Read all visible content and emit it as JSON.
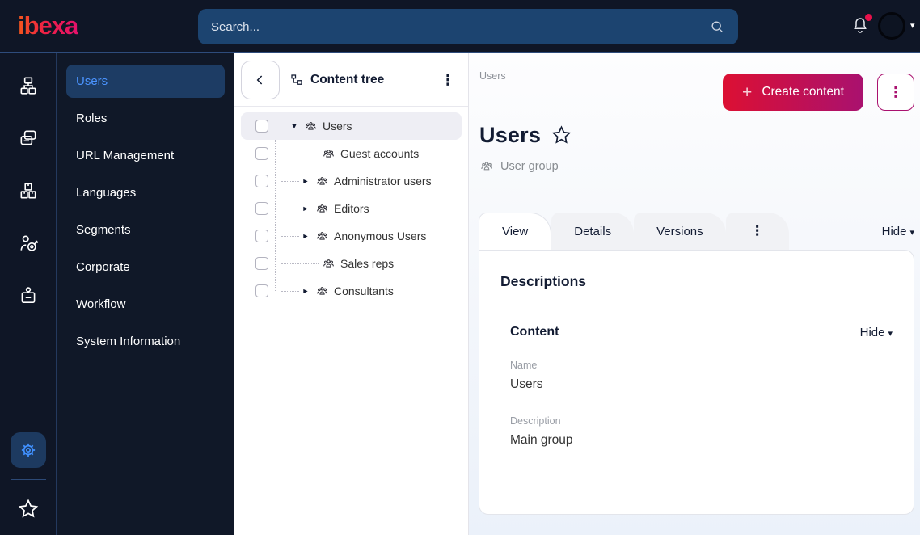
{
  "topbar": {
    "logo_text": "ibexa",
    "search_placeholder": "Search..."
  },
  "icons": {
    "caret_down": "▼",
    "caret_right": "►",
    "kebab": "⋮",
    "dropdown_caret": "▾",
    "plus": "+"
  },
  "sidebar": {
    "selected": "Users",
    "items": [
      "Users",
      "Roles",
      "URL Management",
      "Languages",
      "Segments",
      "Corporate",
      "Workflow",
      "System Information"
    ]
  },
  "content_tree": {
    "title": "Content tree",
    "items": [
      {
        "label": "Users",
        "expanded": true,
        "has_children": true,
        "selected": true
      },
      {
        "label": "Guest accounts",
        "has_children": false
      },
      {
        "label": "Administrator users",
        "has_children": true
      },
      {
        "label": "Editors",
        "has_children": true
      },
      {
        "label": "Anonymous Users",
        "has_children": true
      },
      {
        "label": "Sales reps",
        "has_children": false
      },
      {
        "label": "Consultants",
        "has_children": true
      }
    ]
  },
  "main": {
    "breadcrumb": "Users",
    "create_button_label": "Create content",
    "title": "Users",
    "content_type": "User group",
    "tabs": [
      "View",
      "Details",
      "Versions"
    ],
    "hide_label": "Hide",
    "panel": {
      "heading": "Descriptions",
      "section_title": "Content",
      "section_hide_label": "Hide",
      "fields": [
        {
          "label": "Name",
          "value": "Users"
        },
        {
          "label": "Description",
          "value": "Main group"
        }
      ]
    }
  },
  "colors": {
    "dark_bg": "#0f1626",
    "search_bg": "#1c4470",
    "selected_nav_bg": "#1d3c64",
    "link_blue": "#4191ff",
    "accent_gradient_start": "#dc1033",
    "accent_gradient_end": "#a9116f",
    "notification_badge": "#e8114b",
    "selected_tree_row_bg": "#eeeef4"
  }
}
